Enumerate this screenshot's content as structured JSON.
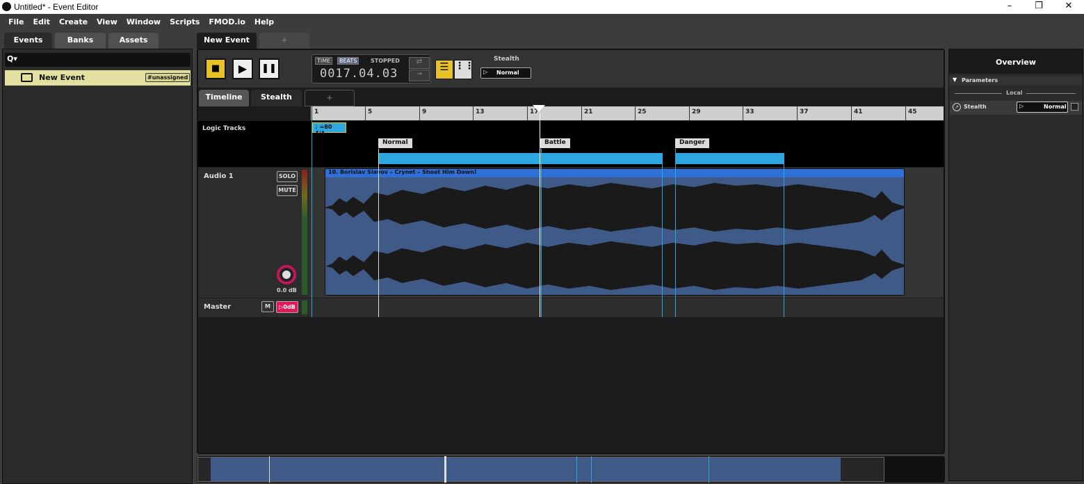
{
  "window": {
    "title": "Untitled* - Event Editor"
  },
  "menu": [
    "File",
    "Edit",
    "Create",
    "View",
    "Window",
    "Scripts",
    "FMOD.io",
    "Help"
  ],
  "browser": {
    "tabs": [
      "Events",
      "Banks",
      "Assets"
    ],
    "search_icon_label": "Q▾",
    "events": [
      {
        "name": "New Event",
        "tag": "#unassigned"
      }
    ]
  },
  "editor": {
    "tabs": [
      "New Event",
      "+"
    ],
    "transport": {
      "time_label": "TIME",
      "beats_label": "BEATS",
      "status": "STOPPED",
      "position": "0017.04.03",
      "param_name": "Stealth",
      "param_value": "Normal"
    },
    "subtabs": [
      "Timeline",
      "Stealth",
      "+"
    ],
    "ruler": [
      "1",
      "5",
      "9",
      "13",
      "17",
      "21",
      "25",
      "29",
      "33",
      "37",
      "41",
      "45"
    ],
    "logic": {
      "label": "Logic Tracks",
      "tempo": "=80 4/4",
      "markers": [
        "Normal",
        "Battle",
        "Danger"
      ]
    },
    "audio_track": {
      "name": "Audio 1",
      "solo": "SOLO",
      "mute": "MUTE",
      "volume": "0.0 dB",
      "clip_name": "10. Borislav Slavov – Crynet – Shoot Him Down!"
    },
    "master": {
      "name": "Master",
      "m": "M",
      "level": "0dB"
    }
  },
  "overview": {
    "title": "Overview",
    "section": "Parameters",
    "group": "Local",
    "param_name": "Stealth",
    "param_value": "Normal"
  },
  "colors": {
    "accent_yellow": "#e8c227",
    "region_blue": "#2ea6df",
    "clip_blue": "#3f5a86"
  }
}
